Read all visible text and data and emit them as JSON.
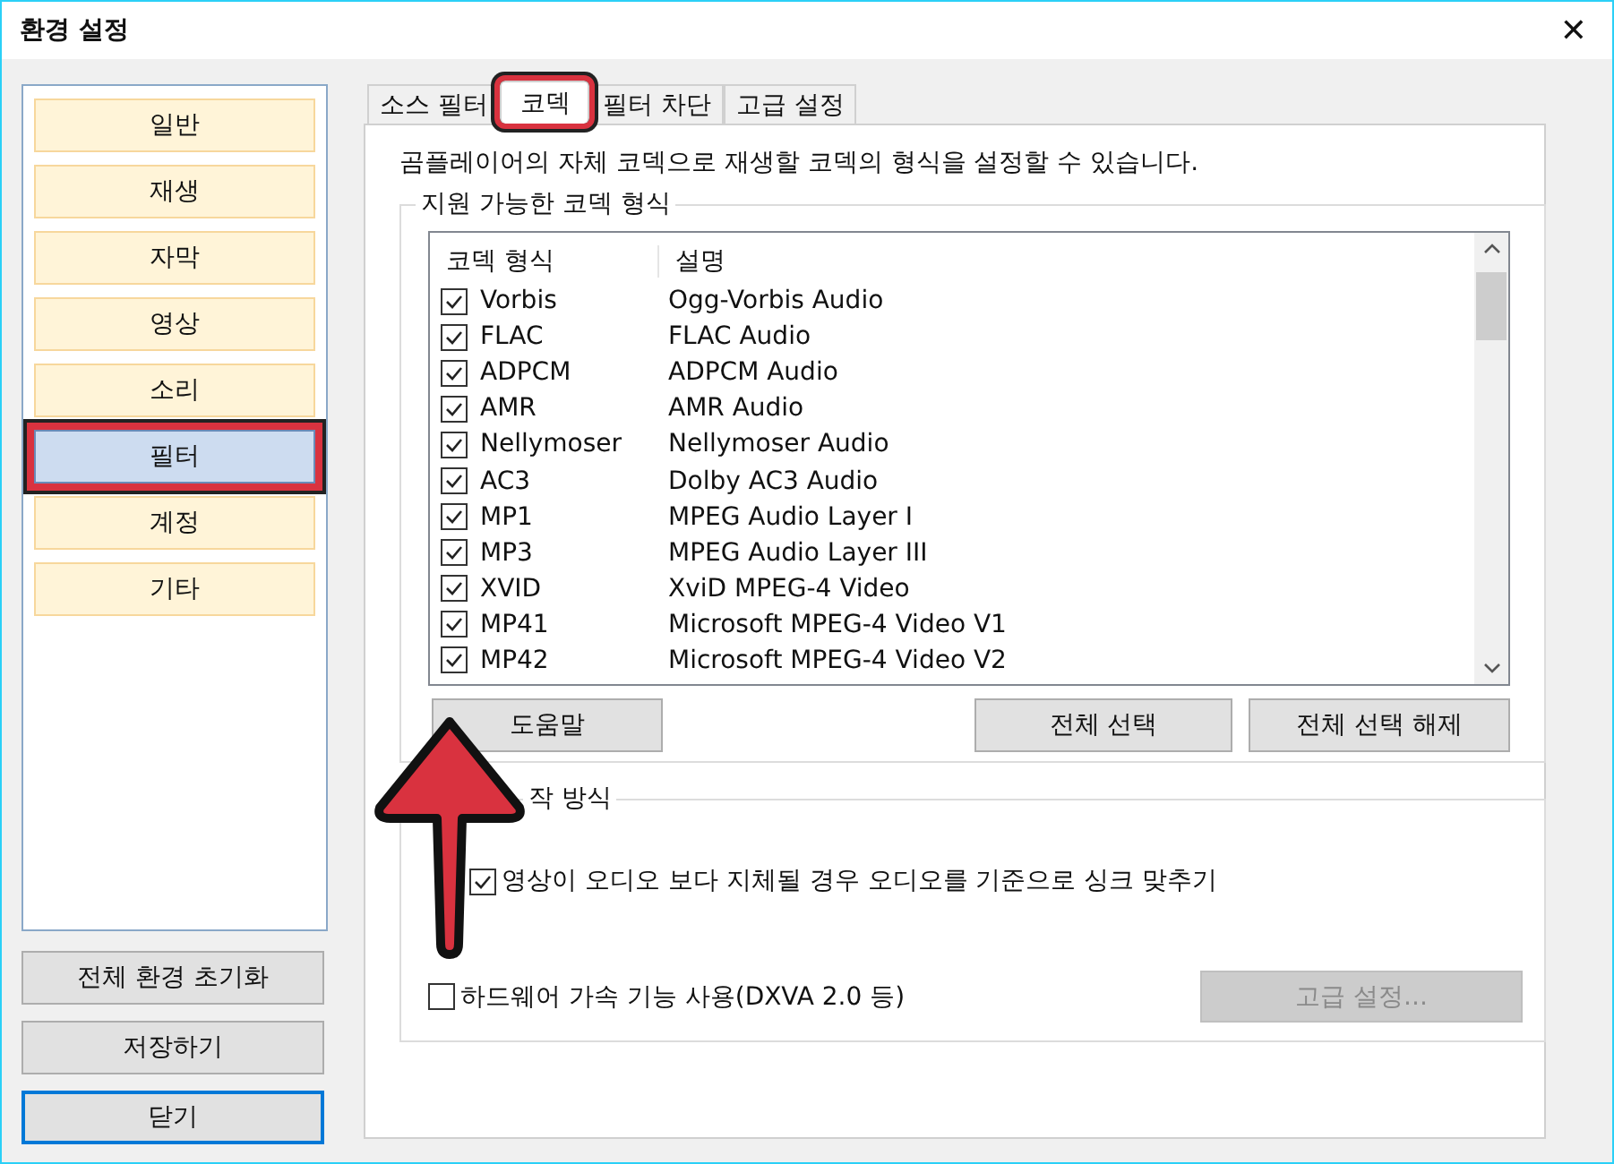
{
  "window": {
    "title": "환경 설정",
    "close": "✕"
  },
  "sidebar": {
    "items": [
      {
        "label": "일반",
        "selected": false,
        "annotated": false
      },
      {
        "label": "재생",
        "selected": false,
        "annotated": false
      },
      {
        "label": "자막",
        "selected": false,
        "annotated": false
      },
      {
        "label": "영상",
        "selected": false,
        "annotated": false
      },
      {
        "label": "소리",
        "selected": false,
        "annotated": false
      },
      {
        "label": "필터",
        "selected": true,
        "annotated": true
      },
      {
        "label": "계정",
        "selected": false,
        "annotated": false
      },
      {
        "label": "기타",
        "selected": false,
        "annotated": false
      }
    ],
    "buttons": [
      {
        "label": "전체 환경 초기화",
        "default": false
      },
      {
        "label": "저장하기",
        "default": false
      },
      {
        "label": "닫기",
        "default": true
      }
    ]
  },
  "tabs": [
    {
      "label": "소스 필터",
      "selected": false,
      "annotated": false
    },
    {
      "label": "코덱",
      "selected": true,
      "annotated": true
    },
    {
      "label": "필터 차단",
      "selected": false,
      "annotated": false
    },
    {
      "label": "고급 설정",
      "selected": false,
      "annotated": false
    }
  ],
  "description": "곰플레이어의 자체 코덱으로 재생할 코덱의 형식을 설정할 수 있습니다.",
  "codec_group": {
    "title": "지원 가능한 코덱 형식",
    "columns": [
      "코덱 형식",
      "설명"
    ],
    "rows": [
      {
        "name": "Vorbis",
        "desc": "Ogg-Vorbis Audio",
        "checked": true
      },
      {
        "name": "FLAC",
        "desc": "FLAC Audio",
        "checked": true
      },
      {
        "name": "ADPCM",
        "desc": "ADPCM Audio",
        "checked": true
      },
      {
        "name": "AMR",
        "desc": "AMR Audio",
        "checked": true
      },
      {
        "name": "Nellymoser",
        "desc": "Nellymoser Audio",
        "checked": true
      },
      {
        "name": "AC3",
        "desc": "Dolby AC3 Audio",
        "checked": true
      },
      {
        "name": "MP1",
        "desc": "MPEG Audio Layer I",
        "checked": true
      },
      {
        "name": "MP3",
        "desc": "MPEG Audio Layer III",
        "checked": true
      },
      {
        "name": "XVID",
        "desc": "XviD MPEG-4 Video",
        "checked": true
      },
      {
        "name": "MP41",
        "desc": "Microsoft MPEG-4 Video V1",
        "checked": true
      },
      {
        "name": "MP42",
        "desc": "Microsoft MPEG-4 Video V2",
        "checked": true
      }
    ],
    "buttons": [
      {
        "label": "도움말"
      },
      {
        "label": "전체 선택"
      },
      {
        "label": "전체 선택 해제"
      }
    ]
  },
  "behavior_group": {
    "title": "작 방식",
    "options": [
      {
        "label": "영상이 오디오 보다 지체될 경우 오디오를 기준으로 싱크 맞추기",
        "checked": true
      },
      {
        "label": "하드웨어 가속 기능 사용(DXVA 2.0 등)",
        "checked": false
      }
    ],
    "advanced_button": {
      "label": "고급 설정...",
      "disabled": true
    }
  }
}
